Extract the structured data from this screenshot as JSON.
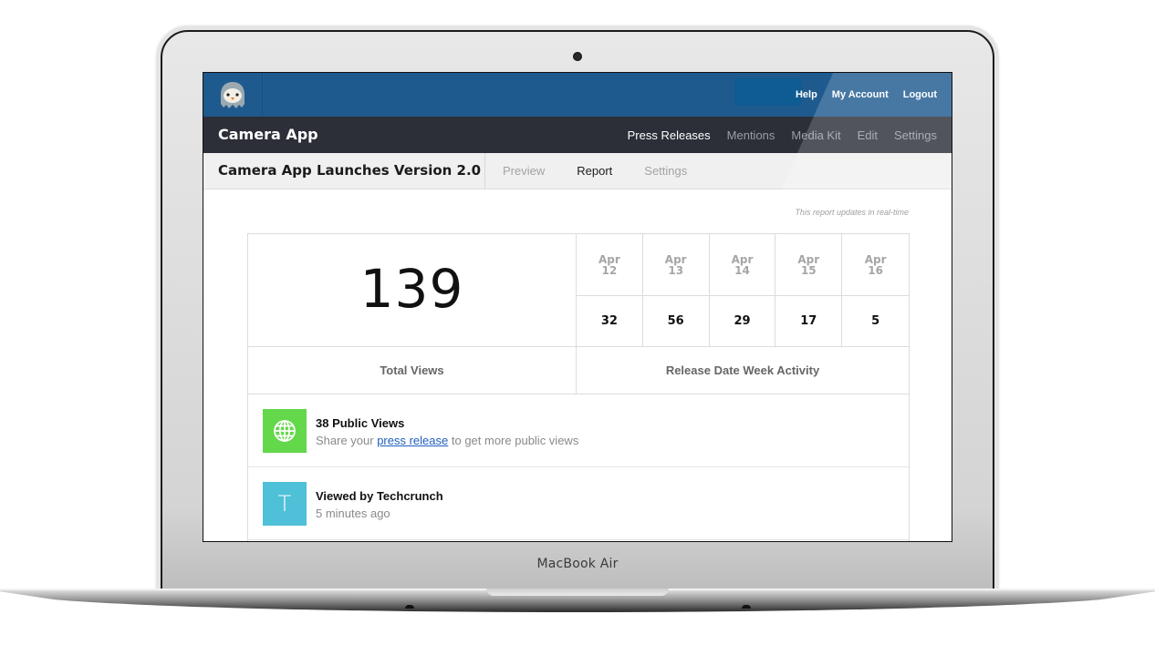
{
  "device": {
    "brand_label": "MacBook Air"
  },
  "topbar": {
    "logo_icon": "owl-logo-icon",
    "links": [
      "Help",
      "My Account",
      "Logout"
    ]
  },
  "appbar": {
    "title": "Camera App",
    "nav": [
      {
        "label": "Press Releases",
        "active": true
      },
      {
        "label": "Mentions",
        "active": false
      },
      {
        "label": "Media Kit",
        "active": false
      },
      {
        "label": "Edit",
        "active": false
      },
      {
        "label": "Settings",
        "active": false
      }
    ]
  },
  "subbar": {
    "title": "Camera App Launches Version 2.0",
    "tabs": [
      {
        "label": "Preview",
        "active": false
      },
      {
        "label": "Report",
        "active": true
      },
      {
        "label": "Settings",
        "active": false
      }
    ]
  },
  "report": {
    "realtime_note": "This report updates in real-time",
    "total_views": "139",
    "total_views_label": "Total Views",
    "week_label": "Release Date Week Activity",
    "days": [
      {
        "month": "Apr",
        "day": "12",
        "views": "32"
      },
      {
        "month": "Apr",
        "day": "13",
        "views": "56"
      },
      {
        "month": "Apr",
        "day": "14",
        "views": "29"
      },
      {
        "month": "Apr",
        "day": "15",
        "views": "17"
      },
      {
        "month": "Apr",
        "day": "16",
        "views": "5"
      }
    ]
  },
  "activity": [
    {
      "icon": "globe-icon",
      "icon_color": "#62d84a",
      "title": "38 Public Views",
      "sub_before": "Share your ",
      "sub_link": "press release",
      "sub_after": " to get more public views"
    },
    {
      "icon": "letter-avatar",
      "initial": "T",
      "icon_color": "#4ec0d8",
      "title": "Viewed by Techcrunch",
      "sub": "5 minutes ago"
    }
  ],
  "colors": {
    "topbar": "#1f5a8f",
    "appbar": "#2c2f38",
    "link": "#1f5fbf"
  }
}
